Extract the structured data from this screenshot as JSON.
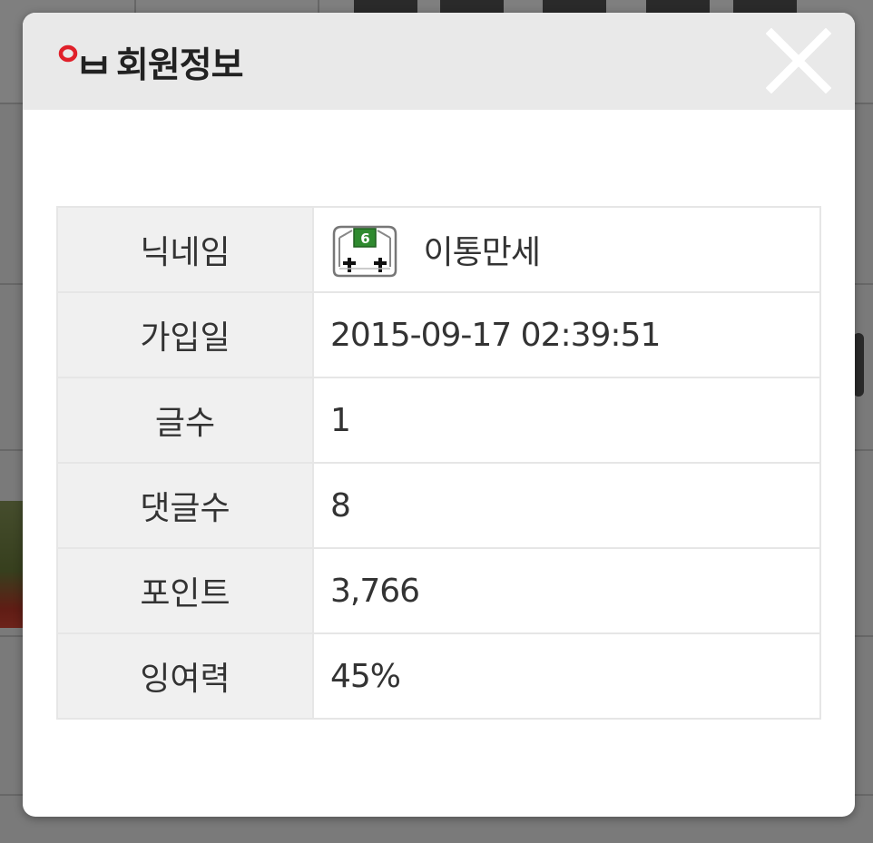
{
  "modal": {
    "title": "회원정보",
    "logo_text": "ㅇㅂ",
    "close_icon": "close-icon"
  },
  "info_rows": [
    {
      "label": "닉네임",
      "value": "이통만세",
      "level_icon": "level-badge-icon",
      "level_badge_text": "6"
    },
    {
      "label": "가입일",
      "value": "2015-09-17 02:39:51"
    },
    {
      "label": "글수",
      "value": "1"
    },
    {
      "label": "댓글수",
      "value": "8"
    },
    {
      "label": "포인트",
      "value": "3,766"
    },
    {
      "label": "잉여력",
      "value": "45%"
    }
  ],
  "colors": {
    "header_bg": "#e9e9e9",
    "label_bg": "#f0f0f0",
    "border": "#e6e6e6",
    "logo_red": "#e0202a",
    "close_icon": "#ffffff"
  }
}
